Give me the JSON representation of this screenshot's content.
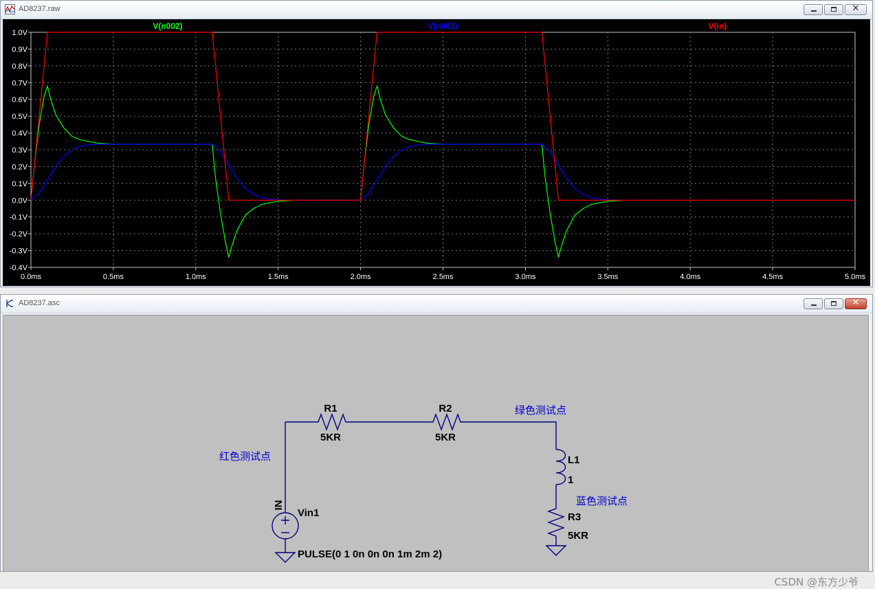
{
  "waveform_window": {
    "title": "AD8237.raw",
    "icon": "waveform-icon",
    "controls": [
      "minimize-icon",
      "maximize-icon",
      "close-icon"
    ]
  },
  "chart_data": {
    "type": "line",
    "xlim": [
      0,
      5
    ],
    "ylim": [
      -0.4,
      1.0
    ],
    "x_ticks": [
      "0.0ms",
      "0.5ms",
      "1.0ms",
      "1.5ms",
      "2.0ms",
      "2.5ms",
      "3.0ms",
      "3.5ms",
      "4.0ms",
      "4.5ms",
      "5.0ms"
    ],
    "y_ticks": [
      "1.0V",
      "0.9V",
      "0.8V",
      "0.7V",
      "0.6V",
      "0.5V",
      "0.4V",
      "0.3V",
      "0.2V",
      "0.1V",
      "0.0V",
      "-0.1V",
      "-0.2V",
      "-0.3V",
      "-0.4V"
    ],
    "grid": true,
    "background": "#000000",
    "series": [
      {
        "name": "V(n002)",
        "color": "#00ff00",
        "x": [
          0,
          0.02,
          0.05,
          0.08,
          0.1,
          0.12,
          0.15,
          0.2,
          0.25,
          0.3,
          0.4,
          0.5,
          1.0,
          1.1,
          1.12,
          1.15,
          1.18,
          1.2,
          1.22,
          1.25,
          1.3,
          1.35,
          1.4,
          1.5,
          1.6,
          2.0,
          2.02,
          2.05,
          2.08,
          2.1,
          2.12,
          2.15,
          2.2,
          2.25,
          2.3,
          2.4,
          2.5,
          3.0,
          3.1,
          3.12,
          3.15,
          3.18,
          3.2,
          3.22,
          3.25,
          3.3,
          3.35,
          3.4,
          3.5,
          3.6
        ],
        "y": [
          0,
          0.2,
          0.45,
          0.62,
          0.68,
          0.6,
          0.51,
          0.43,
          0.38,
          0.36,
          0.34,
          0.333,
          0.333,
          0.333,
          0.13,
          -0.08,
          -0.25,
          -0.34,
          -0.27,
          -0.18,
          -0.09,
          -0.05,
          -0.025,
          -0.006,
          0,
          0,
          0.2,
          0.45,
          0.62,
          0.68,
          0.6,
          0.51,
          0.43,
          0.38,
          0.36,
          0.34,
          0.333,
          0.333,
          0.333,
          0.13,
          -0.08,
          -0.25,
          -0.34,
          -0.27,
          -0.18,
          -0.09,
          -0.05,
          -0.025,
          -0.006,
          0
        ]
      },
      {
        "name": "V(n003)",
        "color": "#0000ff",
        "x": [
          0,
          0.05,
          0.1,
          0.15,
          0.2,
          0.25,
          0.3,
          0.35,
          0.4,
          0.5,
          1.0,
          1.1,
          1.15,
          1.2,
          1.25,
          1.3,
          1.35,
          1.4,
          1.45,
          1.5,
          1.6,
          2.0,
          2.05,
          2.1,
          2.15,
          2.2,
          2.25,
          2.3,
          2.35,
          2.4,
          2.5,
          3.0,
          3.1,
          3.15,
          3.2,
          3.25,
          3.3,
          3.35,
          3.4,
          3.45,
          3.5,
          3.6
        ],
        "y": [
          0,
          0.04,
          0.12,
          0.2,
          0.26,
          0.3,
          0.32,
          0.33,
          0.333,
          0.333,
          0.333,
          0.333,
          0.29,
          0.21,
          0.13,
          0.07,
          0.035,
          0.015,
          0.006,
          0.002,
          0,
          0,
          0.04,
          0.12,
          0.2,
          0.26,
          0.3,
          0.32,
          0.33,
          0.333,
          0.333,
          0.333,
          0.333,
          0.29,
          0.21,
          0.13,
          0.07,
          0.035,
          0.015,
          0.006,
          0.002,
          0
        ]
      },
      {
        "name": "V(in)",
        "color": "#ff0000",
        "x": [
          0,
          0.1,
          1.1,
          1.2,
          2.0,
          2.1,
          3.1,
          3.2,
          5.0
        ],
        "y": [
          0,
          1.0,
          1.0,
          0,
          0,
          1.0,
          1.0,
          0,
          0
        ]
      }
    ]
  },
  "schematic_window": {
    "title": "AD8237.asc",
    "icon": "schematic-icon",
    "controls": [
      "minimize-icon",
      "maximize-icon",
      "close-icon"
    ],
    "background": "#c0c0c0",
    "wire_color": "#000080",
    "components": {
      "r1": {
        "name": "R1",
        "value": "5KR"
      },
      "r2": {
        "name": "R2",
        "value": "5KR"
      },
      "l1": {
        "name": "L1",
        "value": "1"
      },
      "r3": {
        "name": "R3",
        "value": "5KR"
      },
      "vin1": {
        "name": "Vin1",
        "value": "PULSE(0 1 0n 0n 0n 1m 2m 2)"
      }
    },
    "net_label_in": "IN",
    "labels": {
      "red": "红色测试点",
      "green": "绿色测试点",
      "blue": "蓝色测试点"
    }
  },
  "watermark": "CSDN @东方少爷"
}
